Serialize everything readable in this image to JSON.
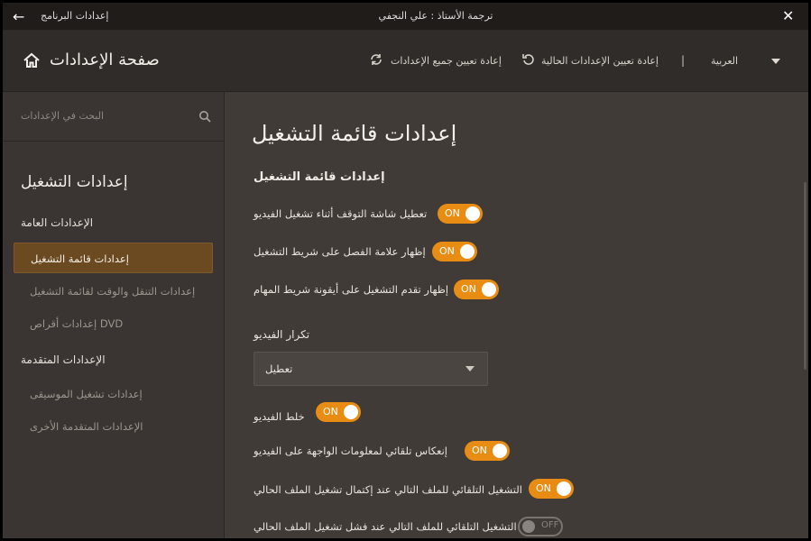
{
  "titlebar": {
    "app_title": "إعدادات البرنامج",
    "center_title": "ترجمة الأستاذ : علي النجفي"
  },
  "header": {
    "page_title": "صفحة الإعدادات",
    "language": "العربية",
    "separator": "|",
    "reset_current": "إعادة تعيين الإعدادات الحالية",
    "reset_all": "إعادة تعيين جميع الإعدادات"
  },
  "sidebar": {
    "search_placeholder": "البحث في الإعدادات",
    "heading": "إعدادات التشغيل",
    "group_general": "الإعدادات العامة",
    "items_general": [
      "إعدادات قائمة التشغيل",
      "إعدادات التنقل والوقت لقائمة التشغيل",
      "إعدادات أقراص DVD"
    ],
    "group_advanced": "الإعدادات المتقدمة",
    "items_advanced": [
      "إعدادات تشغيل الموسيقى",
      "الإعدادات المتقدمة الأخرى"
    ],
    "active_index": 0
  },
  "main": {
    "title": "إعدادات قائمة التشغيل",
    "section_title": "إعدادات قائمة التشغيل",
    "toggles_top": [
      {
        "label": "تعطيل شاشة التوقف أثناء تشغيل الفيديو",
        "state": "ON"
      },
      {
        "label": "إظهار علامة الفصل على شريط التشغيل",
        "state": "ON"
      },
      {
        "label": "إظهار تقدم التشغيل على أيقونة شريط المهام",
        "state": "ON"
      }
    ],
    "repeat_label": "تكرار الفيديو",
    "repeat_value": "تعطيل",
    "toggles_bottom": [
      {
        "label": "خلط الفيديو",
        "state": "ON"
      },
      {
        "label": "إنعكاس تلقائي لمعلومات الواجهة على الفيديو",
        "state": "ON"
      },
      {
        "label": "التشغيل التلقائي للملف التالي عند إكتمال تشغيل الملف الحالي",
        "state": "ON"
      },
      {
        "label": "التشغيل التلقائي للملف التالي عند فشل تشغيل الملف الحالي",
        "state": "OFF"
      }
    ]
  },
  "colors": {
    "accent": "#e98c13",
    "active_item_bg": "#6b4a22",
    "background": "#403b37"
  }
}
